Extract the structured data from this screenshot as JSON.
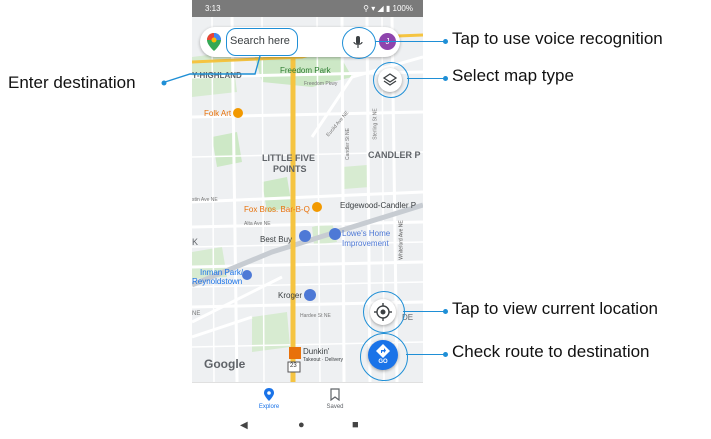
{
  "status_bar": {
    "time": "3:13",
    "indicators": "100%"
  },
  "search": {
    "placeholder": "Search here",
    "avatar_initial": "J"
  },
  "map": {
    "labels": {
      "highland": "Y-HIGHLAND",
      "freedom_park": "Freedom Park",
      "freedom_pkwy": "Freedom Pkwy",
      "folk_art": "Folk Art",
      "euclid": "Euclid Ave NE",
      "candler_st": "Candler St NE",
      "sterling": "Sterling St NE",
      "little_five_1": "LITTLE FIVE",
      "little_five_2": "POINTS",
      "candler_park": "CANDLER P",
      "austin": "stin Ave NE",
      "fox_bros": "Fox Bros. Bar-B-Q",
      "edgewood": "Edgewood-Candler P",
      "alta": "Alta Ave NE",
      "best_buy": "Best Buy",
      "lowes_1": "Lowe's Home",
      "lowes_2": "Improvement",
      "whiteford": "Whiteford Ave NE",
      "inman_1": "Inman Park/",
      "inman_2": "Reynoldstown",
      "kroger": "Kroger",
      "hardee": "Hardee St NE",
      "dunkin": "Dunkin'",
      "dunkin_sub": "Takeout · Delivery",
      "route": "23",
      "google": "Google",
      "k_left": "K",
      "ne_left": "NE",
      "de_right": "DE"
    },
    "go_label": "GO"
  },
  "tabs": {
    "explore": "Explore",
    "saved": "Saved"
  },
  "annotations": {
    "voice": "Tap to use voice recognition",
    "destination": "Enter destination",
    "map_type": "Select map type",
    "location": "Tap to view current location",
    "route": "Check route to destination"
  },
  "colors": {
    "callout": "#1f8fd6",
    "go_button": "#1a73e8",
    "highway": "#f5c441",
    "park": "#cde8c6"
  }
}
